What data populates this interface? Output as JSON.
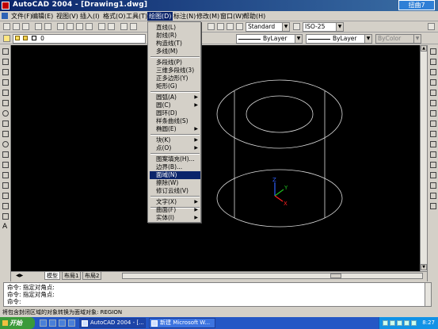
{
  "window": {
    "title": "AutoCAD 2004 - [Drawing1.dwg]",
    "badge": "扭曲7"
  },
  "menubar": {
    "items": [
      {
        "label": "文件(F)"
      },
      {
        "label": "编辑(E)"
      },
      {
        "label": "视图(V)"
      },
      {
        "label": "插入(I)"
      },
      {
        "label": "格式(O)"
      },
      {
        "label": "工具(T)"
      },
      {
        "label": "绘图(D)"
      },
      {
        "label": "标注(N)"
      },
      {
        "label": "修改(M)"
      },
      {
        "label": "窗口(W)"
      },
      {
        "label": "帮助(H)"
      }
    ],
    "active_index": 6
  },
  "toolbar": {
    "text_style": "Standard",
    "dim_style": "ISO-25"
  },
  "layers_bar": {
    "layer": "0",
    "linetype": "ByLayer",
    "lineweight": "ByLayer",
    "color": "ByColor"
  },
  "draw_menu": {
    "items": [
      {
        "label": "直线(L)",
        "submenu": false
      },
      {
        "label": "射线(R)",
        "submenu": false
      },
      {
        "label": "构造线(T)",
        "submenu": false
      },
      {
        "label": "多线(M)",
        "submenu": false
      },
      {
        "label": "多段线(P)",
        "submenu": false
      },
      {
        "label": "三维多段线(3)",
        "submenu": false
      },
      {
        "label": "正多边形(Y)",
        "submenu": false
      },
      {
        "label": "矩形(G)",
        "submenu": false
      },
      {
        "label": "圆弧(A)",
        "submenu": true
      },
      {
        "label": "圆(C)",
        "submenu": true
      },
      {
        "label": "圆环(D)",
        "submenu": false
      },
      {
        "label": "样条曲线(S)",
        "submenu": false
      },
      {
        "label": "椭圆(E)",
        "submenu": true
      },
      {
        "label": "块(K)",
        "submenu": true
      },
      {
        "label": "点(O)",
        "submenu": true
      },
      {
        "label": "图案填充(H)...",
        "submenu": false
      },
      {
        "label": "边界(B)...",
        "submenu": false
      },
      {
        "label": "面域(N)",
        "submenu": false
      },
      {
        "label": "擦除(W)",
        "submenu": false
      },
      {
        "label": "修订云线(V)",
        "submenu": false
      },
      {
        "label": "文字(X)",
        "submenu": true
      },
      {
        "label": "曲面(F)",
        "submenu": true
      },
      {
        "label": "实体(I)",
        "submenu": true
      }
    ],
    "highlighted_index": 17
  },
  "ucs": {
    "x_label": "X",
    "y_label": "Y",
    "z_label": "Z"
  },
  "layout_tabs": [
    {
      "label": "模型"
    },
    {
      "label": "布局1"
    },
    {
      "label": "布局2"
    }
  ],
  "command_lines": [
    "命令: 指定对角点:",
    "命令: 指定对角点:",
    "命令:"
  ],
  "status_text": "将包含封闭区域的对象转换为面域对象:   REGION",
  "taskbar": {
    "start_label": "开始",
    "tasks": [
      {
        "label": "AutoCAD 2004 - [..."
      },
      {
        "label": "新建 Microsoft W..."
      }
    ],
    "clock": "8:27"
  },
  "colors": {
    "title_bar": "#0a246a",
    "canvas": "#000000",
    "menu_highlight": "#0a246a",
    "taskbar": "#2457c5",
    "start_button": "#3a9a3a"
  }
}
